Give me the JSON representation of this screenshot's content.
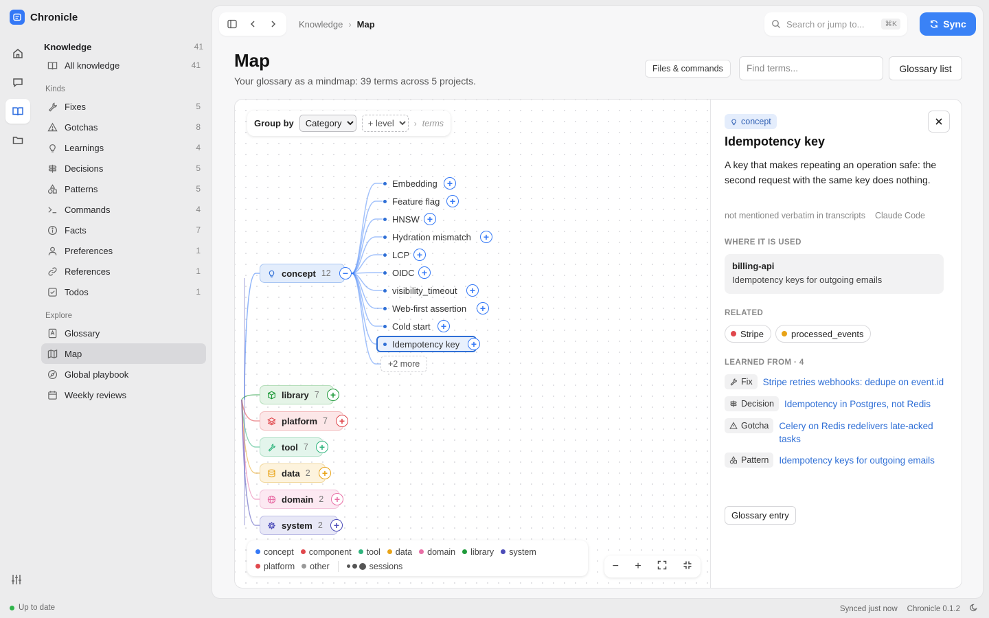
{
  "app": {
    "title": "Chronicle"
  },
  "nav": {
    "header": {
      "label": "Knowledge",
      "count": "41"
    },
    "all": {
      "label": "All knowledge",
      "count": "41"
    },
    "kinds_label": "Kinds",
    "kinds": [
      {
        "label": "Fixes",
        "count": "5",
        "icon": "wrench-icon"
      },
      {
        "label": "Gotchas",
        "count": "8",
        "icon": "warning-icon"
      },
      {
        "label": "Learnings",
        "count": "4",
        "icon": "lightbulb-icon"
      },
      {
        "label": "Decisions",
        "count": "5",
        "icon": "signpost-icon"
      },
      {
        "label": "Patterns",
        "count": "5",
        "icon": "shapes-icon"
      },
      {
        "label": "Commands",
        "count": "4",
        "icon": "terminal-icon"
      },
      {
        "label": "Facts",
        "count": "7",
        "icon": "info-icon"
      },
      {
        "label": "Preferences",
        "count": "1",
        "icon": "user-icon"
      },
      {
        "label": "References",
        "count": "1",
        "icon": "link-icon"
      },
      {
        "label": "Todos",
        "count": "1",
        "icon": "checkbox-icon"
      }
    ],
    "explore_label": "Explore",
    "explore": [
      {
        "label": "Glossary",
        "icon": "book-a-icon"
      },
      {
        "label": "Map",
        "icon": "map-icon"
      },
      {
        "label": "Global playbook",
        "icon": "compass-icon"
      },
      {
        "label": "Weekly reviews",
        "icon": "calendar-icon"
      }
    ]
  },
  "status": {
    "left": "Up to date",
    "synced": "Synced just now",
    "version": "Chronicle 0.1.2"
  },
  "topbar": {
    "crumb_parent": "Knowledge",
    "crumb_current": "Map",
    "search_placeholder": "Search or jump to...",
    "search_kbd": "⌘K",
    "sync_label": "Sync"
  },
  "page": {
    "title": "Map",
    "subtitle": "Your glossary as a mindmap: 39 terms across 5 projects.",
    "files_button": "Files & commands",
    "find_placeholder": "Find terms...",
    "glossary_button": "Glossary list"
  },
  "groupbar": {
    "label": "Group by",
    "group_value": "Category",
    "level_value": "+ level",
    "terms_label": "terms"
  },
  "mindmap": {
    "concept": {
      "label": "concept",
      "count": "12"
    },
    "terms": [
      "Embedding",
      "Feature flag",
      "HNSW",
      "Hydration mismatch",
      "LCP",
      "OIDC",
      "visibility_timeout",
      "Web-first assertion",
      "Cold start",
      "Idempotency key"
    ],
    "selected_term": "Idempotency key",
    "more_label": "+2 more",
    "categories": [
      {
        "label": "library",
        "count": "7"
      },
      {
        "label": "platform",
        "count": "7"
      },
      {
        "label": "tool",
        "count": "7"
      },
      {
        "label": "data",
        "count": "2"
      },
      {
        "label": "domain",
        "count": "2"
      },
      {
        "label": "system",
        "count": "2"
      }
    ]
  },
  "legend": {
    "row1": [
      {
        "label": "concept",
        "color": "#3478f6"
      },
      {
        "label": "component",
        "color": "#e0474c"
      },
      {
        "label": "tool",
        "color": "#2fb47d"
      },
      {
        "label": "data",
        "color": "#e8a317"
      },
      {
        "label": "domain",
        "color": "#e86fa6"
      },
      {
        "label": "library",
        "color": "#1f9a3a"
      },
      {
        "label": "system",
        "color": "#4b4bb8"
      }
    ],
    "row2": [
      {
        "label": "platform",
        "color": "#e0474c"
      },
      {
        "label": "other",
        "color": "#999999"
      }
    ],
    "sessions_label": "sessions"
  },
  "zoom": {
    "minus": "−",
    "plus": "+"
  },
  "detail": {
    "tag": "concept",
    "title": "Idempotency key",
    "description": "A key that makes repeating an operation safe: the second request with the same key does nothing.",
    "meta1": "not mentioned verbatim in transcripts",
    "meta2": "Claude Code",
    "used_heading": "WHERE IT IS USED",
    "used_project": "billing-api",
    "used_text": "Idempotency keys for outgoing emails",
    "related_heading": "RELATED",
    "related": [
      {
        "label": "Stripe",
        "color": "#e0474c"
      },
      {
        "label": "processed_events",
        "color": "#e8a317"
      }
    ],
    "learned_heading": "LEARNED FROM · 4",
    "learned": [
      {
        "kind": "Fix",
        "title": "Stripe retries webhooks: dedupe on event.id",
        "icon": "wrench-icon"
      },
      {
        "kind": "Decision",
        "title": "Idempotency in Postgres, not Redis",
        "icon": "signpost-icon"
      },
      {
        "kind": "Gotcha",
        "title": "Celery on Redis redelivers late-acked tasks",
        "icon": "warning-icon"
      },
      {
        "kind": "Pattern",
        "title": "Idempotency keys for outgoing emails",
        "icon": "shapes-icon"
      }
    ],
    "entry_button": "Glossary entry"
  }
}
